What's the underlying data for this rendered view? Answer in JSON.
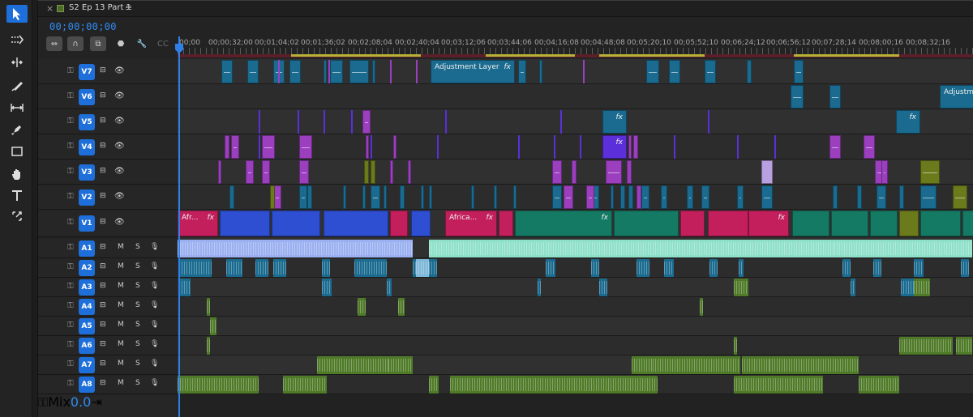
{
  "sequence": {
    "tab_close": "×",
    "tab_title": "S2 Ep 13 Part 1",
    "tab_menu": "≡",
    "timecode": "00;00;00;00",
    "ruler_labels": [
      "00;00",
      "00;00;32;00",
      "00;01;04;02",
      "00;01;36;02",
      "00;02;08;04",
      "00;02;40;04",
      "00;03;12;06",
      "00;03;44;06",
      "00;04;16;08",
      "00;04;48;08",
      "00;05;20;10",
      "00;05;52;10",
      "00;06;24;12",
      "00;06;56;12",
      "00;07;28;14",
      "00;08;00;16",
      "00;08;32;16"
    ]
  },
  "tools": [
    "selection-tool",
    "track-select-tool",
    "ripple-edit-tool",
    "razor-tool",
    "slip-tool",
    "pen-tool",
    "rectangle-tool",
    "hand-tool",
    "type-tool",
    "remix-tool"
  ],
  "video_tracks": [
    {
      "name": "V7",
      "id": "v7"
    },
    {
      "name": "V6",
      "id": "v6"
    },
    {
      "name": "V5",
      "id": "v5"
    },
    {
      "name": "V4",
      "id": "v4"
    },
    {
      "name": "V3",
      "id": "v3"
    },
    {
      "name": "V2",
      "id": "v2"
    },
    {
      "name": "V1",
      "id": "v1"
    }
  ],
  "audio_tracks": [
    {
      "name": "A1",
      "id": "a1"
    },
    {
      "name": "A2",
      "id": "a2"
    },
    {
      "name": "A3",
      "id": "a3"
    },
    {
      "name": "A4",
      "id": "a4"
    },
    {
      "name": "A5",
      "id": "a5"
    },
    {
      "name": "A6",
      "id": "a6"
    },
    {
      "name": "A7",
      "id": "a7"
    },
    {
      "name": "A8",
      "id": "a8"
    }
  ],
  "audio_controls": {
    "mute": "M",
    "solo": "S"
  },
  "mix": {
    "label": "Mix",
    "value": "0.0"
  },
  "clip_labels": {
    "adjustment_layer": "Adjustment Layer",
    "adjustment_short": "Adjustm...",
    "afr": "Afr...",
    "africa": "Africa...",
    "fx": "fx"
  },
  "colors": {
    "accent": "#1e6fd9",
    "timecode": "#2f8cf3",
    "clip_blue_teal": "#1a6b8f",
    "clip_violet": "#9b3fbf",
    "clip_purple": "#5b2fd9",
    "clip_olive": "#6b7a1a",
    "clip_magenta": "#c21f5c",
    "clip_royal": "#2e4fd1",
    "clip_green": "#147a64",
    "audio_green": "#4f7a28",
    "audio_mint": "#8fe0c8",
    "audio_lavender": "#9bb0f0"
  }
}
